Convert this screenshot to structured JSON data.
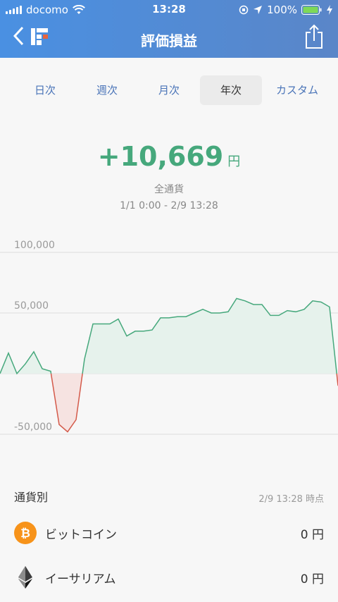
{
  "status_bar": {
    "carrier": "docomo",
    "time": "13:28",
    "battery": "100%"
  },
  "nav": {
    "title": "評価損益"
  },
  "tabs": [
    {
      "label": "日次"
    },
    {
      "label": "週次"
    },
    {
      "label": "月次"
    },
    {
      "label": "年次",
      "active": true
    },
    {
      "label": "カスタム"
    }
  ],
  "summary": {
    "value": "+10,669",
    "unit": "円",
    "currency_scope": "全通貨",
    "range": "1/1 0:00 - 2/9 13:28"
  },
  "chart_data": {
    "type": "area",
    "y_ticks": [
      "100,000",
      "50,000",
      "-50,000"
    ],
    "ylim": [
      -60000,
      110000
    ],
    "values": [
      0,
      17000,
      0,
      8000,
      18000,
      4000,
      2000,
      -42000,
      -48000,
      -38000,
      12000,
      41000,
      41000,
      41000,
      45000,
      31000,
      35000,
      35000,
      36000,
      46000,
      46000,
      47000,
      47000,
      50000,
      53000,
      50000,
      50000,
      51000,
      62000,
      60000,
      57000,
      57000,
      48000,
      48000,
      52000,
      51000,
      53000,
      60000,
      59000,
      55000,
      -10000
    ],
    "colors": {
      "positive_line": "#46a87c",
      "positive_fill": "#e6f2ec",
      "negative_line": "#d45a4a",
      "negative_fill": "#f6e3e1",
      "grid": "#dedede"
    }
  },
  "holdings": {
    "section_label": "通貨別",
    "as_of": "2/9 13:28 時点",
    "items": [
      {
        "name": "ビットコイン",
        "value": "0 円",
        "icon": "bitcoin-icon",
        "color": "#f7931a"
      },
      {
        "name": "イーサリアム",
        "value": "0 円",
        "icon": "ethereum-icon",
        "color": "#3c3c3d"
      }
    ]
  }
}
